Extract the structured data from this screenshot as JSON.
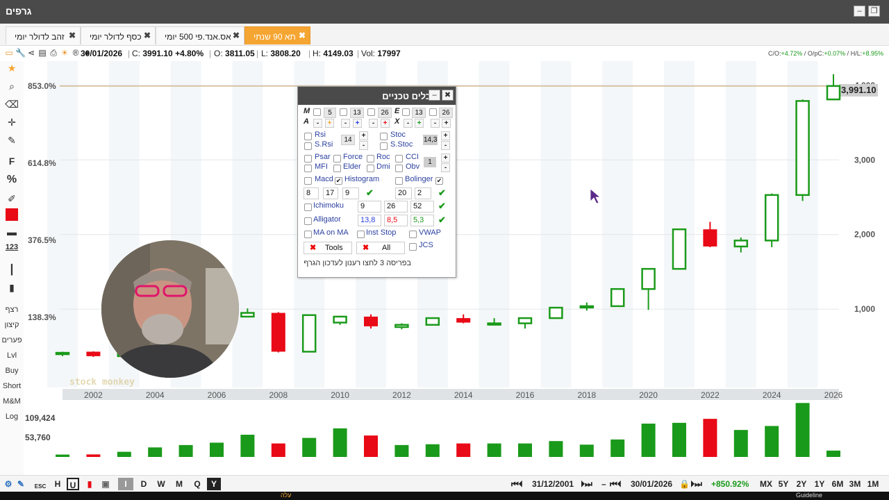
{
  "window": {
    "title": "גרפים",
    "minimize": "–",
    "restore": "❐"
  },
  "tabs": [
    {
      "label": "זהב לדולר יומי",
      "close": "✖"
    },
    {
      "label": "כסף לדולר יומי",
      "close": "✖"
    },
    {
      "label": "אס.אנד.פי 500 יומי",
      "close": "✖"
    },
    {
      "label": "תא 90 שנתי",
      "close": "✖"
    }
  ],
  "info": {
    "date": "30/01/2026",
    "close_label": "C:",
    "close": "3991.10",
    "change": "+4.80%",
    "open_label": "O:",
    "open": "3811.05",
    "low_label": "L:",
    "low": "3808.20",
    "high_label": "H:",
    "high": "4149.03",
    "vol_label": "Vol:",
    "vol": "17997",
    "ratios": {
      "co_label": "C/O:",
      "co": "+4.72%",
      "opc_label": "O/pC:",
      "opc": "+0.07%",
      "hl_label": "H/L:",
      "hl": "+8.95%"
    }
  },
  "left_toolbar": {
    "f_label": "F",
    "pct_label": "%",
    "n123_label": "123",
    "rezef": "רצף",
    "kitzun": "קיצון",
    "pearim": "פערים",
    "lvl": "Lvl",
    "buy": "Buy",
    "short": "Short",
    "mm": "M&M",
    "log": "Log"
  },
  "tools_panel": {
    "title": "כלים טכניים",
    "m_label": "M",
    "a_label": "A",
    "e_label": "E",
    "x_label": "X",
    "ma_values": [
      "5",
      "13",
      "26"
    ],
    "ema_values": [
      "13",
      "26"
    ],
    "rsi": "Rsi",
    "srsi": "S.Rsi",
    "rsi_value": "14",
    "stoc": "Stoc",
    "sstoc": "S.Stoc",
    "stoc_value": "14,3",
    "psar": "Psar",
    "force": "Force",
    "roc": "Roc",
    "cci": "CCI",
    "mfi": "MFI",
    "elder": "Elder",
    "dmi": "Dmi",
    "obv": "Obv",
    "osc_value": "1",
    "macd": "Macd",
    "histogram": "Histogram",
    "bolinger": "Bolinger",
    "macd_values": [
      "8",
      "17",
      "9"
    ],
    "bol_values": [
      "20",
      "2"
    ],
    "ichimoku": "Ichimoku",
    "ichimoku_values": [
      "9",
      "26",
      "52"
    ],
    "alligator": "Alligator",
    "alligator_values": [
      "13,8",
      "8,5",
      "5,3"
    ],
    "ma_on_ma": "MA on MA",
    "inst_stop": "Inst Stop",
    "vwap": "VWAP",
    "jcs": "JCS",
    "tools_btn": "Tools",
    "all_btn": "All",
    "hint": "בפריסה 3 לחצו רענון לעדכון הגרף",
    "plus": "+",
    "minus": "-",
    "check": "✔"
  },
  "bottom_bar": {
    "periods": [
      "I",
      "D",
      "W",
      "M",
      "Q",
      "Y"
    ],
    "start_date": "31/12/2001",
    "end_date": "30/01/2026",
    "change": "+850.92%",
    "ranges": [
      "MX",
      "5Y",
      "2Y",
      "1Y",
      "6M",
      "3M",
      "1M"
    ],
    "esc": "ESC",
    "dash": "–"
  },
  "taskbar": {
    "left": "עלה",
    "right": "Guideline"
  },
  "chart_data": {
    "type": "candlestick",
    "x_ticks": [
      "2002",
      "2004",
      "2006",
      "2008",
      "2010",
      "2012",
      "2014",
      "2016",
      "2018",
      "2020",
      "2022",
      "2024",
      "2026"
    ],
    "y_ticks": [
      "1,000",
      "2,000",
      "3,000",
      "4,000"
    ],
    "left_pct_labels": [
      "853.0%",
      "614.8%",
      "376.5%",
      "138.3%"
    ],
    "last_price": "3,991.10",
    "volume_labels": [
      "109,424",
      "53,760"
    ],
    "watermark": "stock monkey",
    "colors": {
      "up": "#1a9a1a",
      "down": "#e80a16",
      "price_line": "#c8a060"
    },
    "candles": [
      {
        "year": 2001,
        "o": 415,
        "c": 415,
        "h": 430,
        "l": 370
      },
      {
        "year": 2002,
        "o": 430,
        "c": 370,
        "h": 435,
        "l": 360
      },
      {
        "year": 2003,
        "o": 370,
        "c": 530,
        "h": 540,
        "l": 360
      },
      {
        "year": 2004,
        "o": 530,
        "c": 700,
        "h": 710,
        "l": 520
      },
      {
        "year": 2005,
        "o": 700,
        "c": 850,
        "h": 860,
        "l": 690
      },
      {
        "year": 2006,
        "o": 850,
        "c": 900,
        "h": 920,
        "l": 830
      },
      {
        "year": 2007,
        "o": 900,
        "c": 950,
        "h": 1010,
        "l": 890
      },
      {
        "year": 2008,
        "o": 950,
        "c": 430,
        "h": 960,
        "l": 420
      },
      {
        "year": 2009,
        "o": 430,
        "c": 920,
        "h": 930,
        "l": 420
      },
      {
        "year": 2010,
        "o": 820,
        "c": 900,
        "h": 910,
        "l": 790
      },
      {
        "year": 2011,
        "o": 900,
        "c": 770,
        "h": 930,
        "l": 740
      },
      {
        "year": 2012,
        "o": 760,
        "c": 790,
        "h": 810,
        "l": 730
      },
      {
        "year": 2013,
        "o": 790,
        "c": 880,
        "h": 890,
        "l": 780
      },
      {
        "year": 2014,
        "o": 880,
        "c": 820,
        "h": 930,
        "l": 810
      },
      {
        "year": 2015,
        "o": 810,
        "c": 810,
        "h": 880,
        "l": 790
      },
      {
        "year": 2016,
        "o": 810,
        "c": 880,
        "h": 890,
        "l": 740
      },
      {
        "year": 2017,
        "o": 880,
        "c": 1020,
        "h": 1030,
        "l": 870
      },
      {
        "year": 2018,
        "o": 1040,
        "c": 1040,
        "h": 1090,
        "l": 980
      },
      {
        "year": 2019,
        "o": 1040,
        "c": 1270,
        "h": 1280,
        "l": 1030
      },
      {
        "year": 2020,
        "o": 1270,
        "c": 1540,
        "h": 1550,
        "l": 990
      },
      {
        "year": 2021,
        "o": 1540,
        "c": 2070,
        "h": 2080,
        "l": 1530
      },
      {
        "year": 2022,
        "o": 2070,
        "c": 1840,
        "h": 2170,
        "l": 1830
      },
      {
        "year": 2023,
        "o": 1840,
        "c": 1920,
        "h": 1960,
        "l": 1760
      },
      {
        "year": 2024,
        "o": 1920,
        "c": 2530,
        "h": 2550,
        "l": 1830
      },
      {
        "year": 2025,
        "o": 2530,
        "c": 3790,
        "h": 3810,
        "l": 2450
      },
      {
        "year": 2026,
        "o": 3811,
        "c": 3991,
        "h": 4149,
        "l": 3808
      }
    ],
    "volume": [
      3000,
      3200,
      6500,
      12000,
      15000,
      18000,
      28000,
      17000,
      24000,
      36000,
      27000,
      15000,
      16000,
      17000,
      17000,
      17000,
      20000,
      15500,
      22000,
      42000,
      43000,
      48000,
      34000,
      39000,
      68000,
      8000
    ],
    "y_range": [
      -50,
      4250
    ],
    "volume_range": [
      0,
      70000
    ]
  }
}
